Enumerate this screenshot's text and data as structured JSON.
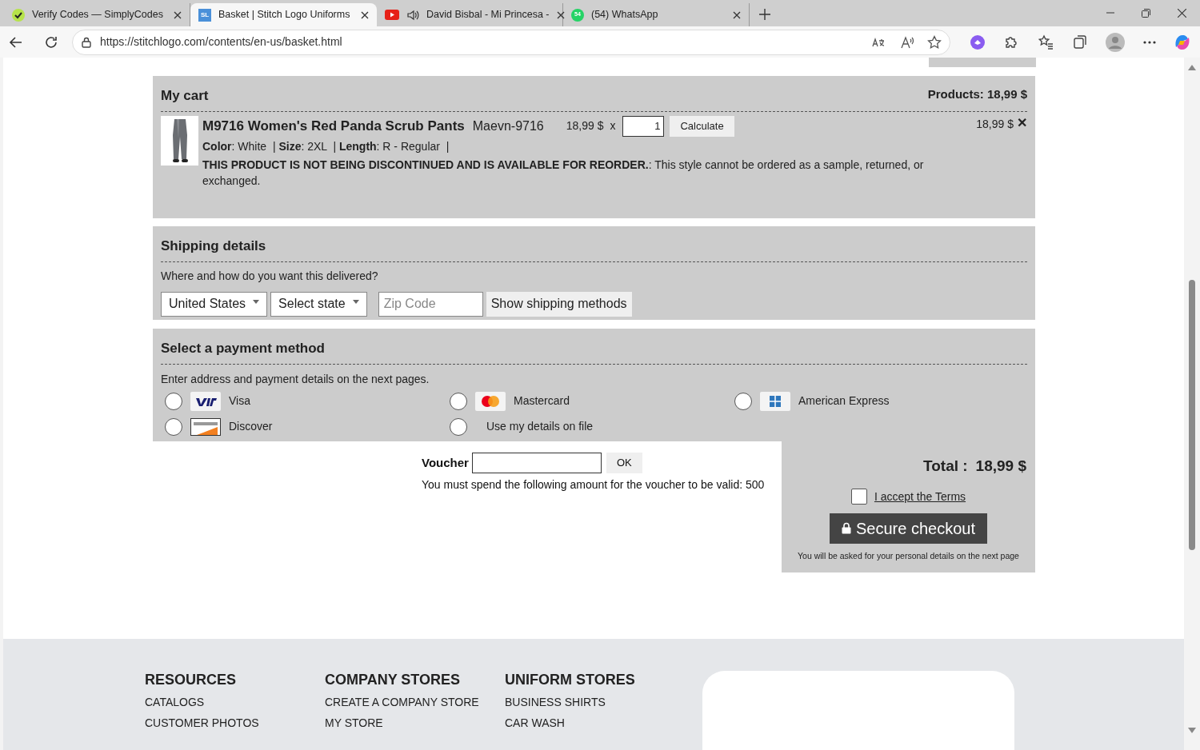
{
  "browser": {
    "tabs": [
      {
        "title": "Verify Codes — SimplyCodes",
        "selected": false,
        "audio": false
      },
      {
        "title": "Basket | Stitch Logo Uniforms",
        "icon_text": "SL",
        "selected": true,
        "audio": false
      },
      {
        "title": "David Bisbal - Mi Princesa -",
        "selected": false,
        "audio": true
      },
      {
        "title": "(54) WhatsApp",
        "icon_text": "54",
        "selected": false,
        "audio": false
      }
    ],
    "address": "https://stitchlogo.com/contents/en-us/basket.html"
  },
  "page": {
    "cart": {
      "title": "My cart",
      "products_total": "Products: 18,99 $",
      "items": [
        {
          "name": "M9716 Women's Red Panda Scrub Pants",
          "sku": "Maevn-9716",
          "unit_price": "18,99 $",
          "times": "x",
          "quantity": "1",
          "calculate": "Calculate",
          "line_total": "18,99 $",
          "remove": "✕",
          "attributes": "**Color**: White  | **Size**: 2XL  | **Length**: R - Regular  |",
          "notice": "**THIS PRODUCT IS NOT BEING DISCONTINUED AND IS AVAILABLE FOR REORDER.**: This style cannot be ordered as a sample, returned, or exchanged."
        }
      ]
    },
    "shipping": {
      "title": "Shipping details",
      "prompt": "Where and how do you want this delivered?",
      "country": "United States",
      "state": "Select state",
      "zip_placeholder": "Zip Code",
      "button": "Show shipping methods"
    },
    "payment": {
      "title": "Select a payment method",
      "hint": "Enter address and payment details on the next pages.",
      "options": [
        {
          "label": "Visa",
          "kind": "visa",
          "selected": false
        },
        {
          "label": "Mastercard",
          "kind": "mastercard",
          "selected": false
        },
        {
          "label": "American Express",
          "kind": "amex",
          "selected": false
        },
        {
          "label": "Discover",
          "kind": "discover",
          "selected": false
        },
        {
          "label": "Use my details on file",
          "kind": "file",
          "selected": false
        }
      ]
    },
    "voucher": {
      "label": "Voucher",
      "button": "OK",
      "note": "You must spend the following amount for the voucher to be valid: 500"
    },
    "checkout": {
      "total_label": "Total :",
      "total": "18,99 $",
      "terms_label": "I accept the Terms",
      "terms_checked": false,
      "button": "Secure checkout",
      "note": "You will be asked for your personal details on the next page"
    },
    "footer": {
      "columns": [
        {
          "heading": "RESOURCES",
          "links": [
            "CATALOGS",
            "CUSTOMER PHOTOS"
          ]
        },
        {
          "heading": "COMPANY STORES",
          "links": [
            "CREATE A COMPANY STORE",
            "MY STORE"
          ]
        },
        {
          "heading": "UNIFORM STORES",
          "links": [
            "BUSINESS SHIRTS",
            "CAR WASH"
          ]
        }
      ]
    }
  }
}
